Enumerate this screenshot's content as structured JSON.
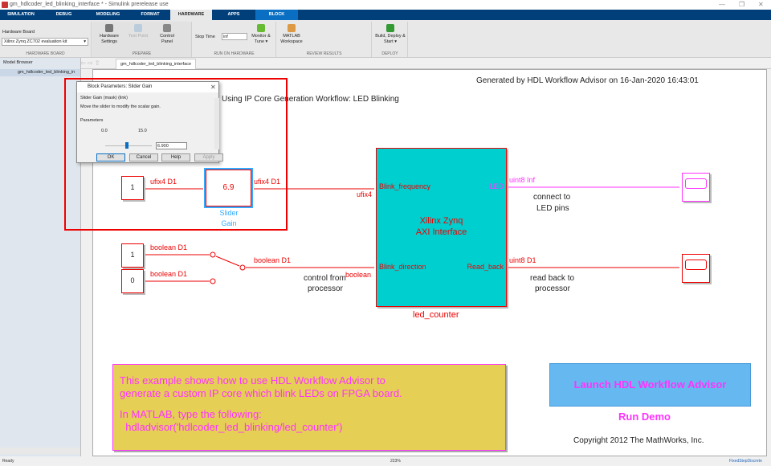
{
  "window": {
    "title": "gm_hdlcoder_led_blinking_interface * - Simulink prerelease use",
    "min": "—",
    "restore": "❐",
    "close": "✕"
  },
  "tabs": [
    "SIMULATION",
    "DEBUG",
    "MODELING",
    "FORMAT",
    "HARDWARE",
    "APPS",
    "BLOCK"
  ],
  "active_tab": "HARDWARE",
  "ribbon": {
    "hardware_board_label": "Hardware Board",
    "hardware_board_value": "Xilinx Zynq ZC702 evaluation kit",
    "hardware_board_group": "HARDWARE BOARD",
    "hardware_settings": "Hardware Settings",
    "test_point": "Test Point",
    "control_panel": "Control Panel",
    "prepare_group": "PREPARE",
    "stop_time_label": "Stop Time",
    "stop_time_value": "inf",
    "monitor_tune": "Monitor & Tune ▾",
    "run_group": "RUN ON HARDWARE",
    "matlab_workspace": "MATLAB Workspace",
    "review_group": "REVIEW RESULTS",
    "build_deploy": "Build, Deploy & Start ▾",
    "deploy_group": "DEPLOY"
  },
  "model_browser": {
    "title": "Model Browser",
    "item": "gm_hdlcoder_led_blinking_in"
  },
  "doc_tab": "gm_hdlcoder_led_blinking_interface",
  "diagram": {
    "generated": "Generated by HDL Workflow Advisor on 16-Jan-2020 16:43:01",
    "subtitle": "Using IP Core Generation Workflow: LED Blinking",
    "const1": "1",
    "sig1": "ufix4 D1",
    "gain_value": "6.9",
    "gain_label1": "Slider",
    "gain_label2": "Gain",
    "sig2": "ufix4 D1",
    "sig2_port": "ufix4",
    "const2": "1",
    "const3": "0",
    "bool1": "boolean D1",
    "bool2": "boolean D1",
    "bool3": "boolean D1",
    "bool_port": "boolean",
    "control_note1": "control from",
    "control_note2": "processor",
    "subsystem_title1": "Xilinx Zynq",
    "subsystem_title2": "AXI Interface",
    "subsystem_name": "led_counter",
    "port_in1": "Blink_frequency",
    "port_in2": "Blink_direction",
    "port_out1": "LED",
    "port_out2": "Read_back",
    "out_sig1": "uint8 Inf",
    "out_sig2": "uint8 D1",
    "led_note1": "connect to",
    "led_note2": "LED pins",
    "rb_note1": "read back to",
    "rb_note2": "processor",
    "note_line1": "This example shows how to use HDL Workflow Advisor to",
    "note_line2": "generate a custom IP core which blink LEDs on FPGA board.",
    "note_line3": "In MATLAB, type the following:",
    "note_line4": "  hdladvisor('hdlcoder_led_blinking/led_counter')",
    "launch_button": "Launch HDL Workflow Advisor",
    "run_demo": "Run Demo",
    "copyright": "Copyright 2012 The MathWorks, Inc."
  },
  "dialog": {
    "title": "Block Parameters: Slider Gain",
    "section": "Slider Gain (mask) (link)",
    "description": "Move the slider to modify the scalar gain.",
    "params": "Parameters",
    "min": "0.0",
    "max": "15.0",
    "value": "6.900",
    "slider_fraction": 0.46,
    "ok": "OK",
    "cancel": "Cancel",
    "help": "Help",
    "apply": "Apply"
  },
  "status": {
    "left": "Ready",
    "zoom": "223%",
    "solver": "FixedStepDiscrete"
  },
  "colors": {
    "signal": "#ee0000",
    "led": "#ff33ff",
    "subsystem": "#00cccc",
    "note_bg": "#e6cf55",
    "launch_bg": "#66b8f0"
  }
}
